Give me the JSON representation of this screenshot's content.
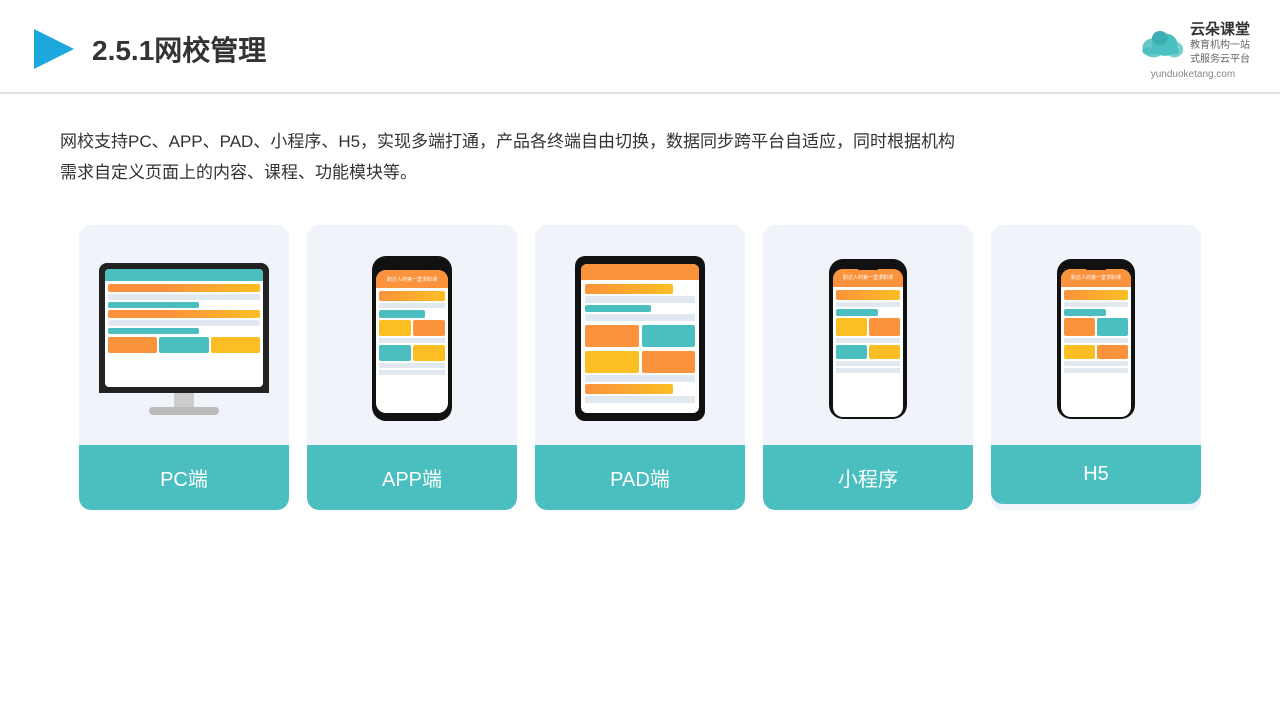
{
  "header": {
    "title": "2.5.1网校管理",
    "brand_name": "云朵课堂",
    "brand_tagline": "教育机构一站\n式服务云平台",
    "brand_url": "yunduoketang.com"
  },
  "description": "网校支持PC、APP、PAD、小程序、H5，实现多端打通，产品各终端自由切换，数据同步跨平台自适应，同时根据机构\n需求自定义页面上的内容、课程、功能模块等。",
  "cards": [
    {
      "id": "pc",
      "label": "PC端"
    },
    {
      "id": "app",
      "label": "APP端"
    },
    {
      "id": "pad",
      "label": "PAD端"
    },
    {
      "id": "miniapp",
      "label": "小程序"
    },
    {
      "id": "h5",
      "label": "H5"
    }
  ],
  "colors": {
    "teal": "#4bbfbf",
    "accent_orange": "#fb923c",
    "text_dark": "#333333",
    "bg_card": "#eef2fa",
    "header_border": "#e0e0e0"
  }
}
